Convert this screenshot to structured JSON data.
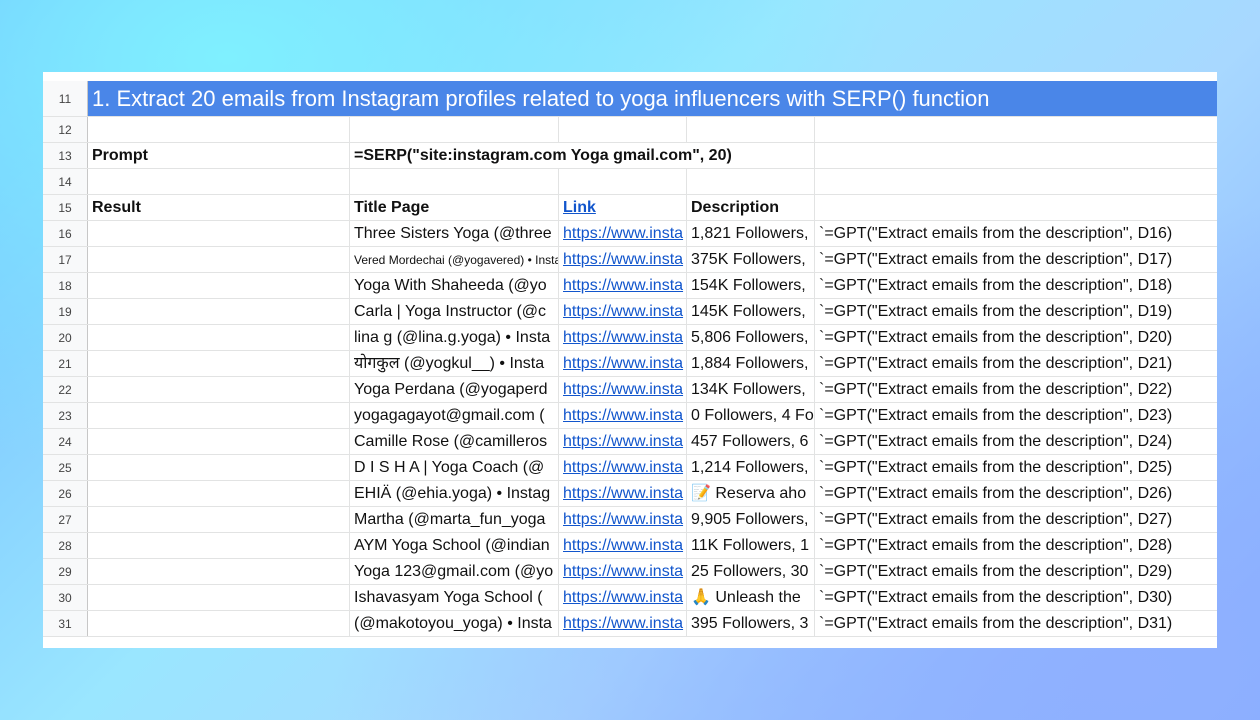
{
  "title_row": {
    "num": "11",
    "text": "1. Extract 20 emails from Instagram profiles related to yoga influencers with SERP() function"
  },
  "row12": {
    "num": "12"
  },
  "prompt_row": {
    "num": "13",
    "label": "Prompt",
    "formula": "=SERP(\"site:instagram.com Yoga gmail.com\", 20)"
  },
  "row14": {
    "num": "14"
  },
  "header_row": {
    "num": "15",
    "result": "Result",
    "title_page": "Title Page",
    "link": "Link",
    "description": "Description"
  },
  "rows": [
    {
      "num": "16",
      "title": "Three Sisters Yoga (@three",
      "link": "https://www.insta",
      "desc": "1,821 Followers,",
      "gpt": "`=GPT(\"Extract emails from the description\", D16)"
    },
    {
      "num": "17",
      "title": "Vered Mordechai (@yogavered) • Insta",
      "link": "https://www.insta",
      "desc": "375K Followers,",
      "gpt": "`=GPT(\"Extract emails from the description\", D17)",
      "small": true
    },
    {
      "num": "18",
      "title": "Yoga With Shaheeda (@yo",
      "link": "https://www.insta",
      "desc": "154K Followers,",
      "gpt": "`=GPT(\"Extract emails from the description\", D18)"
    },
    {
      "num": "19",
      "title": "Carla | Yoga Instructor (@c",
      "link": "https://www.insta",
      "desc": "145K Followers,",
      "gpt": "`=GPT(\"Extract emails from the description\", D19)"
    },
    {
      "num": "20",
      "title": "lina g (@lina.g.yoga) • Insta",
      "link": "https://www.insta",
      "desc": "5,806 Followers,",
      "gpt": "`=GPT(\"Extract emails from the description\", D20)"
    },
    {
      "num": "21",
      "title": "योगकुल (@yogkul__) • Insta",
      "link": "https://www.insta",
      "desc": "1,884 Followers,",
      "gpt": "`=GPT(\"Extract emails from the description\", D21)"
    },
    {
      "num": "22",
      "title": "Yoga Perdana (@yogaperd",
      "link": "https://www.insta",
      "desc": "134K Followers,",
      "gpt": "`=GPT(\"Extract emails from the description\", D22)"
    },
    {
      "num": "23",
      "title": "yogagagayot@gmail.com (",
      "link": "https://www.insta",
      "desc": "0 Followers, 4 Fo",
      "gpt": "`=GPT(\"Extract emails from the description\", D23)"
    },
    {
      "num": "24",
      "title": "Camille Rose (@camilleros",
      "link": "https://www.insta",
      "desc": "457 Followers, 6",
      "gpt": "`=GPT(\"Extract emails from the description\", D24)"
    },
    {
      "num": "25",
      "title": "D I S H A | Yoga Coach (@",
      "link": "https://www.insta",
      "desc": "1,214 Followers,",
      "gpt": "`=GPT(\"Extract emails from the description\", D25)"
    },
    {
      "num": "26",
      "title": "EHIÄ (@ehia.yoga) • Instag",
      "link": "https://www.insta",
      "desc": "📝 Reserva aho",
      "gpt": "`=GPT(\"Extract emails from the description\", D26)"
    },
    {
      "num": "27",
      "title": "Martha (@marta_fun_yoga",
      "link": "https://www.insta",
      "desc": "9,905 Followers,",
      "gpt": "`=GPT(\"Extract emails from the description\", D27)"
    },
    {
      "num": "28",
      "title": "AYM Yoga School (@indian",
      "link": "https://www.insta",
      "desc": "11K Followers, 1",
      "gpt": "`=GPT(\"Extract emails from the description\", D28)"
    },
    {
      "num": "29",
      "title": "Yoga 123@gmail.com (@yo",
      "link": "https://www.insta",
      "desc": "25 Followers, 30",
      "gpt": "`=GPT(\"Extract emails from the description\", D29)"
    },
    {
      "num": "30",
      "title": "Ishavasyam Yoga School (",
      "link": "https://www.insta",
      "desc": "🙏 Unleash the",
      "gpt": "`=GPT(\"Extract emails from the description\", D30)"
    },
    {
      "num": "31",
      "title": "(@makotoyou_yoga) • Insta",
      "link": "https://www.insta",
      "desc": "395 Followers, 3",
      "gpt": "`=GPT(\"Extract emails from the description\", D31)"
    }
  ]
}
